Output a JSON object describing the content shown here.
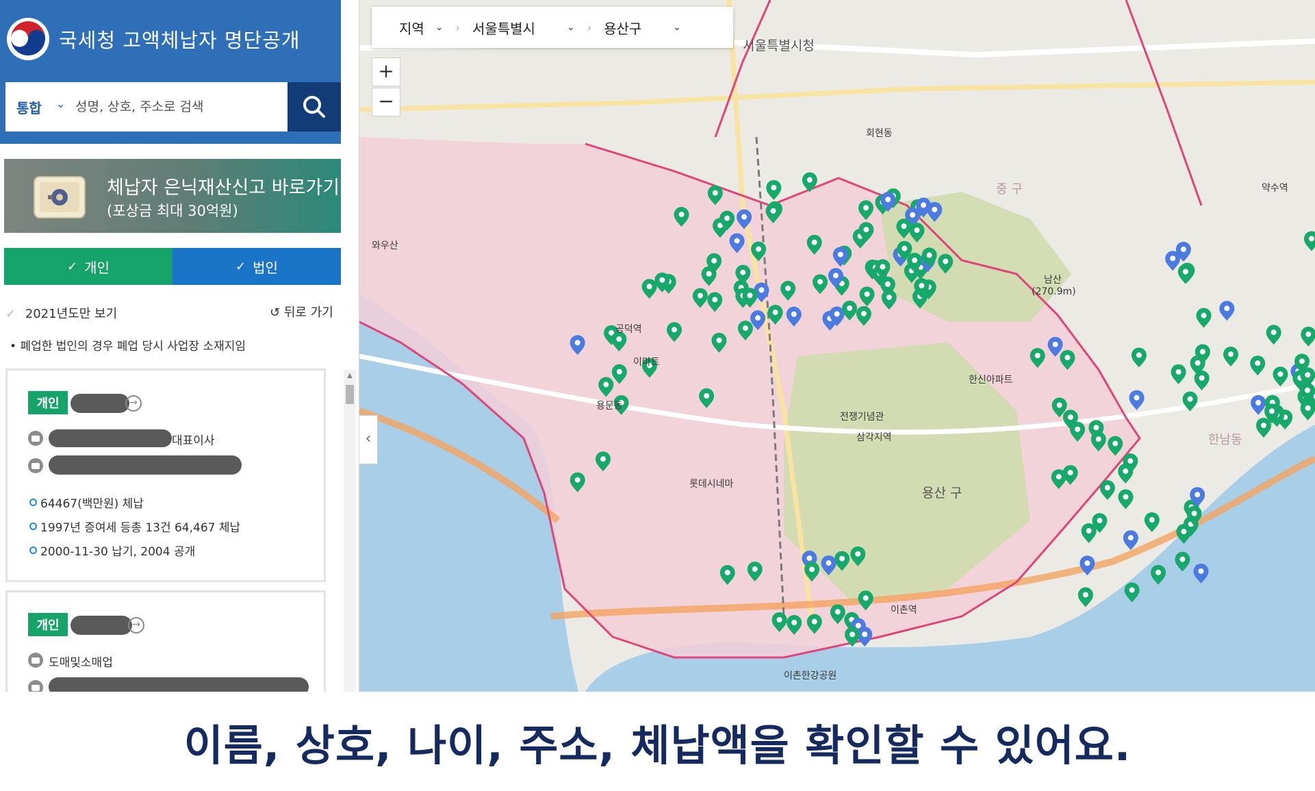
{
  "app": {
    "title": "국세청 고액체납자 명단공개"
  },
  "search": {
    "scope": "통합",
    "placeholder": "성명, 상호, 주소로 검색"
  },
  "banner": {
    "line1": "체납자 은닉재산신고 바로가기",
    "line2": "(포상금 최대 30억원)"
  },
  "filters": {
    "individual": "개인",
    "corporation": "법인",
    "individual_color": "#15a36a",
    "corporation_color": "#1a74c8"
  },
  "options": {
    "year_filter": "2021년도만 보기",
    "back": "뒤로 가기",
    "note": "• 폐업한 법인의 경우 폐업 당시 사업장 소재지임"
  },
  "cards": [
    {
      "type": "개인",
      "business_visible": "대표이사",
      "amount": "64467(백만원) 체납",
      "detail": "1997년 증여세 등총 13건 64,467 체납",
      "dates": "2000-11-30 납기, 2004 공개"
    },
    {
      "type": "개인",
      "business": "도매및소매업"
    }
  ],
  "map": {
    "region_bar": {
      "level1": "지역",
      "level2": "서울특별시",
      "level3": "용산구"
    },
    "zoom_in": "+",
    "zoom_out": "−",
    "labels": {
      "seoul_city_hall": "서울특별시청",
      "yongsan_gu": "용산 구",
      "namsan": "남산",
      "namsan_height": "(270.9m)",
      "junggu": "중 구",
      "samgakji": "삼각지역",
      "ichon": "이촌역",
      "gongdeok": "공덕역",
      "waosan": "와우산",
      "yongmun": "용문동",
      "hanshin": "한신아파트",
      "war_memorial": "전쟁기념관",
      "lotte_cinema": "롯데시네마",
      "emart": "이마트",
      "hoehyeon": "회현동",
      "yaksu": "약수역",
      "hannam": "한남동",
      "ichon_park": "이촌한강공원"
    },
    "marker_colors": {
      "individual": "#17a86b",
      "corporation": "#4b7be0"
    }
  },
  "caption": "이름, 상호, 나이, 주소, 체납액을 확인할 수 있어요."
}
